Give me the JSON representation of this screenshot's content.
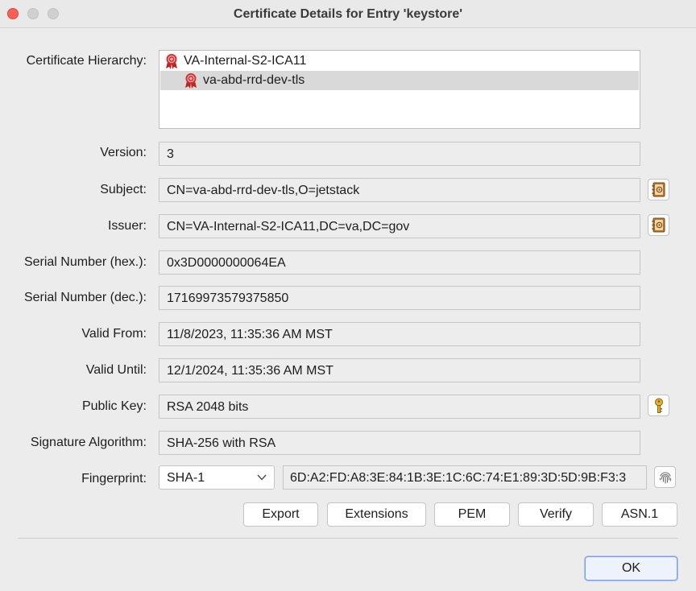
{
  "window": {
    "title": "Certificate Details for Entry 'keystore'"
  },
  "hierarchy": {
    "label": "Certificate Hierarchy:",
    "items": [
      {
        "text": "VA-Internal-S2-ICA11",
        "icon": "certificate-seal-icon"
      },
      {
        "text": "va-abd-rrd-dev-tls",
        "icon": "certificate-seal-icon",
        "selected": true
      }
    ]
  },
  "fields": {
    "version": {
      "label": "Version:",
      "value": "3"
    },
    "subject": {
      "label": "Subject:",
      "value": "CN=va-abd-rrd-dev-tls,O=jetstack"
    },
    "issuer": {
      "label": "Issuer:",
      "value": "CN=VA-Internal-S2-ICA11,DC=va,DC=gov"
    },
    "serial_hex": {
      "label": "Serial Number (hex.):",
      "value": "0x3D0000000064EA"
    },
    "serial_dec": {
      "label": "Serial Number (dec.):",
      "value": "17169973579375850"
    },
    "valid_from": {
      "label": "Valid From:",
      "value": "11/8/2023, 11:35:36 AM MST"
    },
    "valid_until": {
      "label": "Valid Until:",
      "value": "12/1/2024, 11:35:36 AM MST"
    },
    "public_key": {
      "label": "Public Key:",
      "value": "RSA 2048 bits"
    },
    "signature_algorithm": {
      "label": "Signature Algorithm:",
      "value": "SHA-256 with RSA"
    }
  },
  "fingerprint": {
    "label": "Fingerprint:",
    "algorithm": "SHA-1",
    "value": "6D:A2:FD:A8:3E:84:1B:3E:1C:6C:74:E1:89:3D:5D:9B:F3:3"
  },
  "buttons": {
    "export": "Export",
    "extensions": "Extensions",
    "pem": "PEM",
    "verify": "Verify",
    "asn1": "ASN.1",
    "ok": "OK"
  },
  "colors": {
    "accent": "#7fa0e0",
    "seal": "#d0302f",
    "close": "#fe5f57"
  }
}
